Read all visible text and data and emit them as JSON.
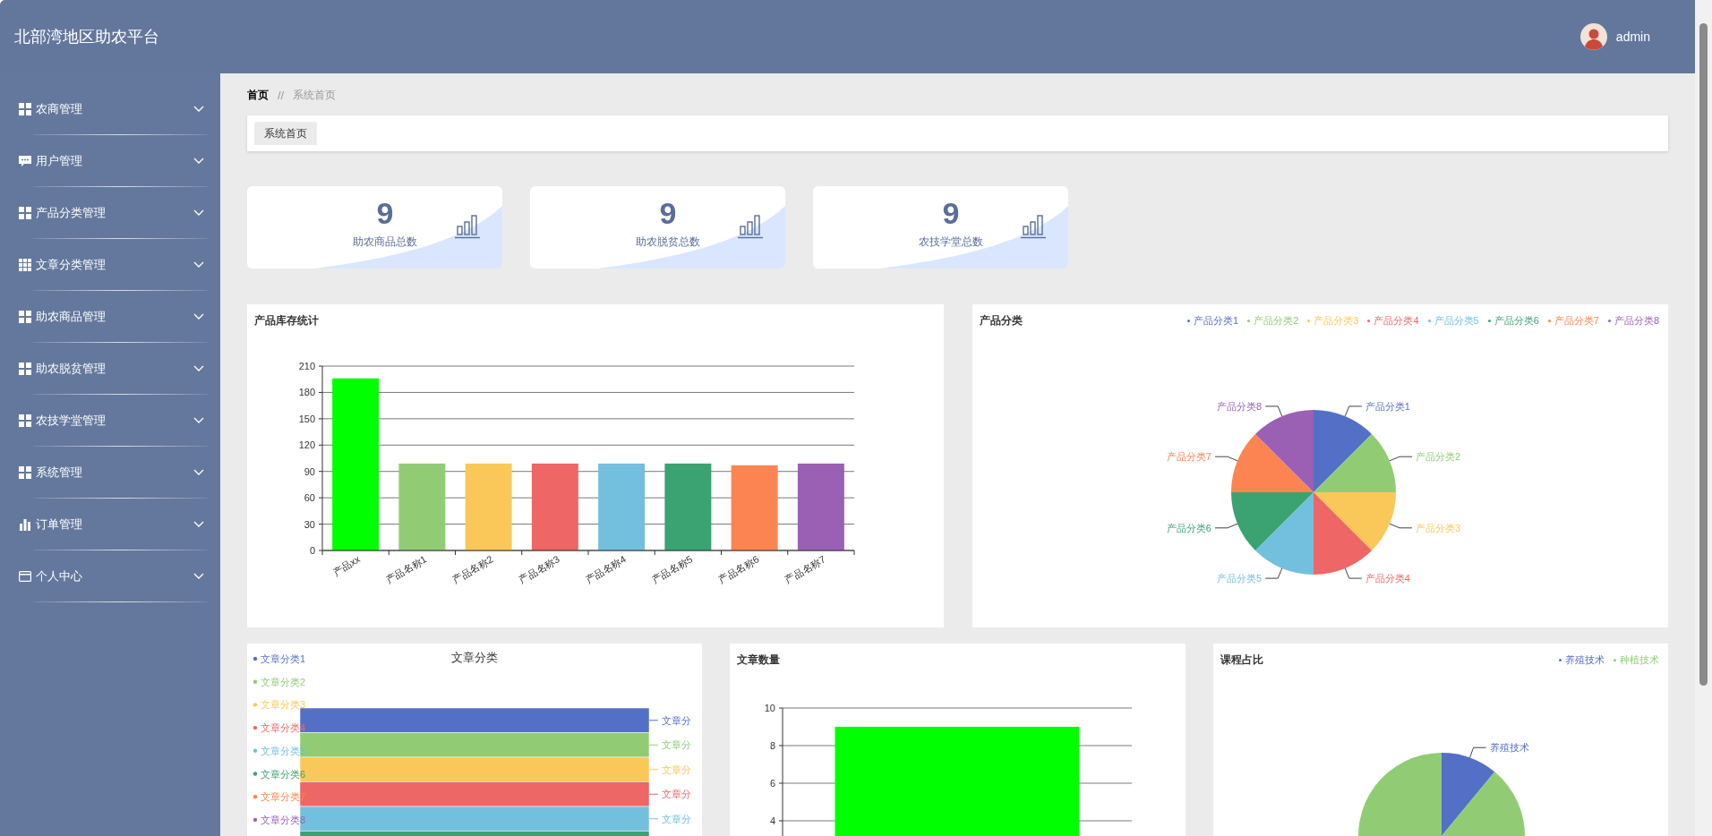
{
  "header": {
    "title": "北部湾地区助农平台",
    "user": "admin"
  },
  "sidebar": {
    "items": [
      {
        "label": "农商管理",
        "expanded": false
      },
      {
        "label": "用户管理",
        "expanded": false
      },
      {
        "label": "产品分类管理",
        "expanded": false
      },
      {
        "label": "文章分类管理",
        "expanded": false
      },
      {
        "label": "助农商品管理",
        "expanded": false
      },
      {
        "label": "助农脱贫管理",
        "expanded": false
      },
      {
        "label": "农技学堂管理",
        "expanded": false
      },
      {
        "label": "系统管理",
        "expanded": false
      },
      {
        "label": "订单管理",
        "expanded": false
      },
      {
        "label": "个人中心",
        "expanded": false
      }
    ]
  },
  "breadcrumb": {
    "items": [
      "首页",
      "系统首页"
    ],
    "separator": "//"
  },
  "tabs": [
    {
      "label": "系统首页",
      "selected": true
    }
  ],
  "stats": [
    {
      "value": "9",
      "label": "助农商品总数"
    },
    {
      "value": "9",
      "label": "助农脱贫总数"
    },
    {
      "value": "9",
      "label": "农技学堂总数"
    }
  ],
  "rows": [
    [
      {
        "kind": "chart",
        "chart_data": {
          "type": "bar",
          "grid": true,
          "title": "产品库存统计",
          "categories": [
            "产品xx",
            "产品名称1",
            "产品名称2",
            "产品名称3",
            "产品名称4",
            "产品名称5",
            "产品名称6",
            "产品名称7"
          ],
          "values": [
            196,
            99,
            99,
            99,
            99,
            99,
            97,
            99
          ],
          "colors": [
            "#00ff00",
            "#91cc75",
            "#fac858",
            "#ee6666",
            "#73c0de",
            "#3ba272",
            "#fc8452",
            "#9a60b4"
          ],
          "ylim": [
            0,
            210
          ],
          "yticks": [
            0,
            30,
            60,
            90,
            120,
            150,
            180,
            210
          ]
        }
      },
      {
        "kind": "chart",
        "chart_data": {
          "type": "pie",
          "title": "产品分类",
          "categories": [
            "产品分类1",
            "产品分类2",
            "产品分类3",
            "产品分类4",
            "产品分类5",
            "产品分类6",
            "产品分类7",
            "产品分类8"
          ],
          "values": [
            1,
            1,
            1,
            1,
            1,
            1,
            1,
            1
          ],
          "colors": [
            "#5470c6",
            "#91cc75",
            "#fac858",
            "#ee6666",
            "#73c0de",
            "#3ba272",
            "#fc8452",
            "#9a60b4"
          ]
        },
        "slice_labels": [
          "产品分类1",
          "产品分类2",
          "产品分类3",
          "产品分类4",
          "产品分类5",
          "产品分类6",
          "产品分类7",
          "产品分类8"
        ]
      }
    ],
    [
      {
        "kind": "funnel",
        "title": "文章分类",
        "legend": [
          {
            "label": "文章分类1",
            "color": "#5470c6"
          },
          {
            "label": "文章分类2",
            "color": "#91cc75"
          },
          {
            "label": "文章分类3",
            "color": "#fac858"
          },
          {
            "label": "文章分类4",
            "color": "#ee6666"
          },
          {
            "label": "文章分类5",
            "color": "#73c0de"
          },
          {
            "label": "文章分类6",
            "color": "#3ba272"
          },
          {
            "label": "文章分类7",
            "color": "#fc8452"
          },
          {
            "label": "文章分类8",
            "color": "#9a60b4"
          }
        ],
        "layer_labels": [
          "文章分",
          "文章分",
          "文章分",
          "文章分",
          "文章分"
        ]
      },
      {
        "kind": "chart",
        "chart_data": {
          "type": "bar",
          "grid": true,
          "title": "文章数量",
          "values": [
            9
          ],
          "colors": [
            "#00ff00"
          ],
          "ylim": [
            0,
            10
          ],
          "yticks": [
            4,
            6,
            8,
            10
          ]
        }
      },
      {
        "kind": "chart",
        "chart_data": {
          "type": "pie",
          "title": "课程占比",
          "categories": [
            "养殖技术",
            "种植技术"
          ],
          "values": [
            11,
            89
          ],
          "colors": [
            "#5470c6",
            "#91cc75"
          ]
        },
        "slice_labels": [
          "养殖技术"
        ]
      }
    ]
  ]
}
